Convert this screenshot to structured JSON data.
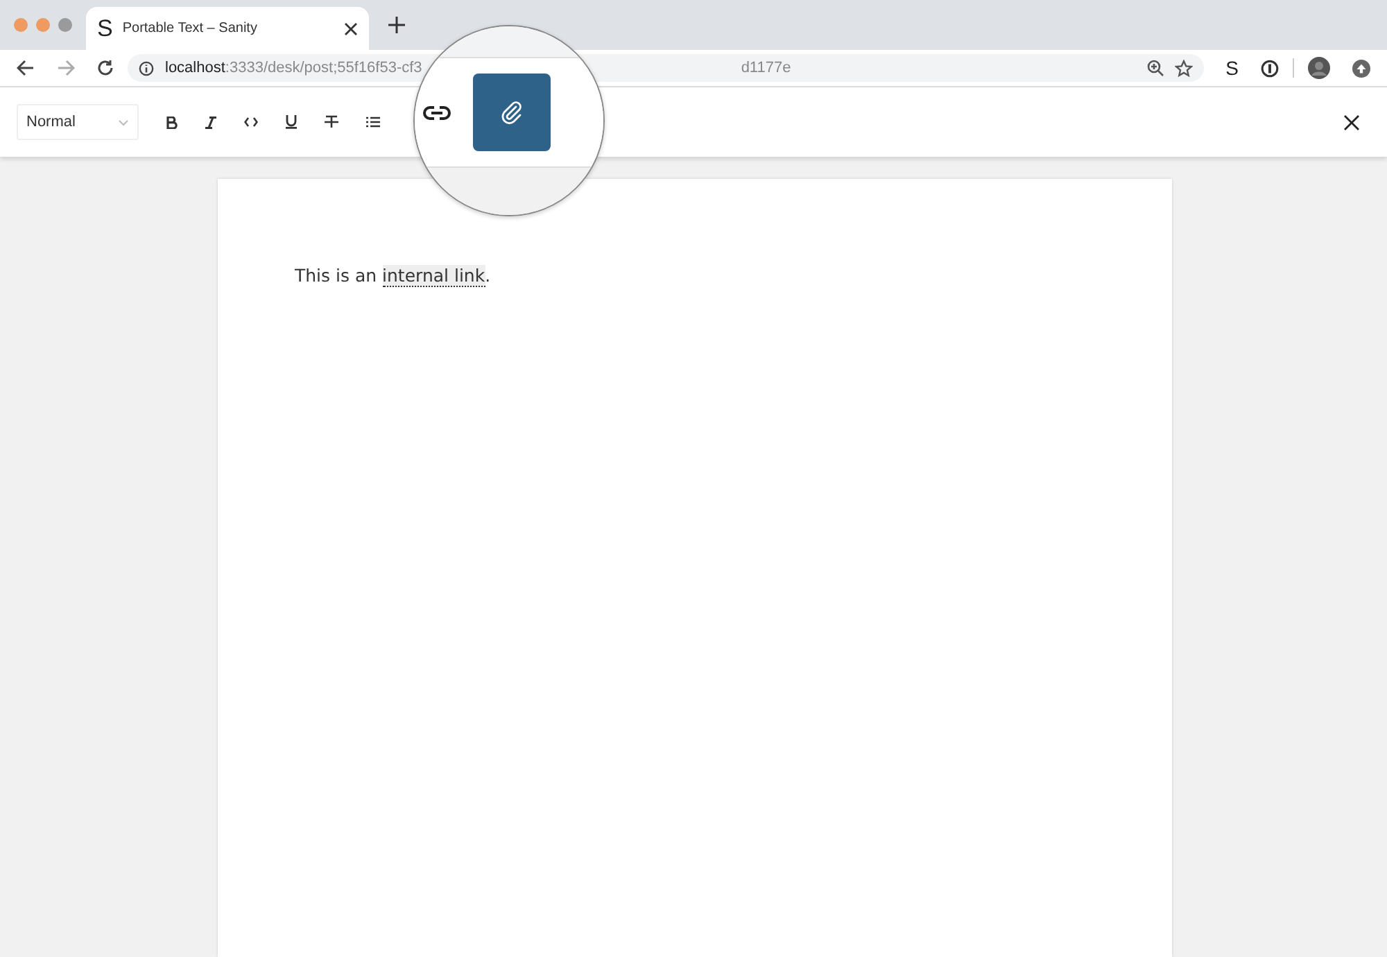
{
  "browser": {
    "tab": {
      "title": "Portable Text – Sanity",
      "favicon": "S"
    },
    "url": {
      "host": "localhost",
      "path": ":3333/desk/post;55f16f53-cf3",
      "tail": "d1177e"
    },
    "extension": "S"
  },
  "toolbar": {
    "style_select": {
      "value": "Normal"
    },
    "buttons": [
      {
        "kind": "bold"
      },
      {
        "kind": "italic"
      },
      {
        "kind": "code"
      },
      {
        "kind": "underline"
      },
      {
        "kind": "strike"
      },
      {
        "kind": "bullet-list"
      }
    ]
  },
  "magnifier": {
    "buttons": [
      {
        "kind": "link",
        "selected": false
      },
      {
        "kind": "attachment",
        "selected": true
      }
    ]
  },
  "document": {
    "paragraph": {
      "before": "This is an ",
      "link": "internal link",
      "after": "."
    }
  }
}
